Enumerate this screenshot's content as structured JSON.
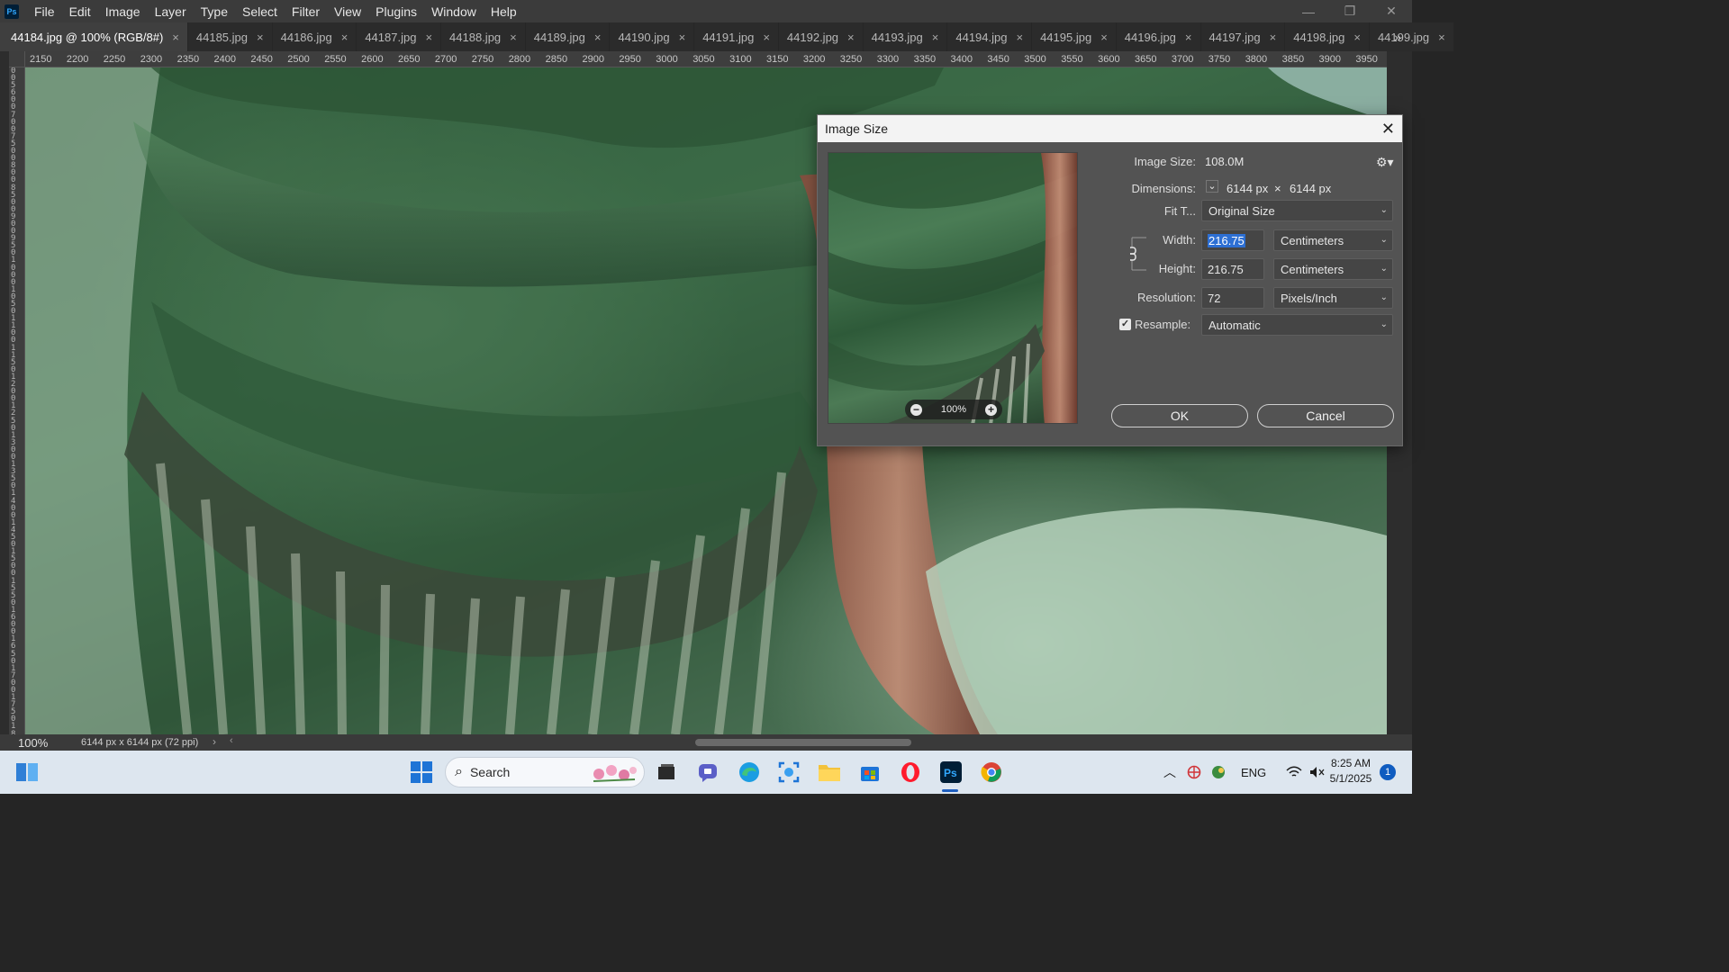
{
  "app": {
    "logo_text": "Ps"
  },
  "menu": [
    "File",
    "Edit",
    "Image",
    "Layer",
    "Type",
    "Select",
    "Filter",
    "View",
    "Plugins",
    "Window",
    "Help"
  ],
  "window_controls": {
    "minimize": "—",
    "restore": "❐",
    "close": "✕"
  },
  "tabs": [
    {
      "label": "44184.jpg @ 100% (RGB/8#)",
      "active": true
    },
    {
      "label": "44185.jpg"
    },
    {
      "label": "44186.jpg"
    },
    {
      "label": "44187.jpg"
    },
    {
      "label": "44188.jpg"
    },
    {
      "label": "44189.jpg"
    },
    {
      "label": "44190.jpg"
    },
    {
      "label": "44191.jpg"
    },
    {
      "label": "44192.jpg"
    },
    {
      "label": "44193.jpg"
    },
    {
      "label": "44194.jpg"
    },
    {
      "label": "44195.jpg"
    },
    {
      "label": "44196.jpg"
    },
    {
      "label": "44197.jpg"
    },
    {
      "label": "44198.jpg"
    },
    {
      "label": "44199.jpg"
    }
  ],
  "tab_close": "×",
  "tab_overflow": "»",
  "ruler": {
    "h_ticks": [
      "2150",
      "2200",
      "2250",
      "2300",
      "2350",
      "2400",
      "2450",
      "2500",
      "2550",
      "2600",
      "2650",
      "2700",
      "2750",
      "2800",
      "2850",
      "2900",
      "2950",
      "3000",
      "3050",
      "3100",
      "3150",
      "3200",
      "3250",
      "3300",
      "3350",
      "3400",
      "3450",
      "3500",
      "3550",
      "3600",
      "3650",
      "3700",
      "3750",
      "3800",
      "3850",
      "3900",
      "3950"
    ],
    "v_digits": "0 0 5 6 0 0 7 0 0 7 5 0 0 8 0 0 8 5 0 0 9 0 0 9 5 0 1 0 0 0 1 0 5 0 1 1 0 0 1 1 5 0 1 2 0 0 1 2 5 0 1 3 0 0 1 3 5 0 1 4 0 0 1 4 5 0 1 5 0 0 1 5 5 0 1 6 0 0 1 6 5 0 1 7 0 0 1 7 5 0 1 8 0 0 1 8 5 0"
  },
  "status": {
    "zoom": "100%",
    "doc_info": "6144 px x 6144 px (72 ppi)",
    "arrow": "›",
    "scroll_left": "‹"
  },
  "dialog": {
    "title": "Image Size",
    "close": "✕",
    "image_size_label": "Image Size:",
    "image_size_value": "108.0M",
    "dimensions_label": "Dimensions:",
    "dimensions_w": "6144 px",
    "dimensions_x": "×",
    "dimensions_h": "6144 px",
    "fit_label": "Fit T...",
    "fit_value": "Original Size",
    "width_label": "Width:",
    "width_value": "216.75",
    "width_unit": "Centimeters",
    "height_label": "Height:",
    "height_value": "216.75",
    "height_unit": "Centimeters",
    "resolution_label": "Resolution:",
    "resolution_value": "72",
    "resolution_unit": "Pixels/Inch",
    "resample_label": "Resample:",
    "resample_checked": true,
    "resample_value": "Automatic",
    "preview_zoom": "100%",
    "ok": "OK",
    "cancel": "Cancel",
    "gear_icon": "gear-icon"
  },
  "taskbar": {
    "search_placeholder": "Search",
    "tray_lang": "ENG",
    "time": "8:25 AM",
    "date": "5/1/2025",
    "notifications": "1"
  },
  "colors": {
    "accent": "#2d6fd3",
    "dialog_bg": "#535353",
    "taskbar_bg": "#dde6ef"
  }
}
